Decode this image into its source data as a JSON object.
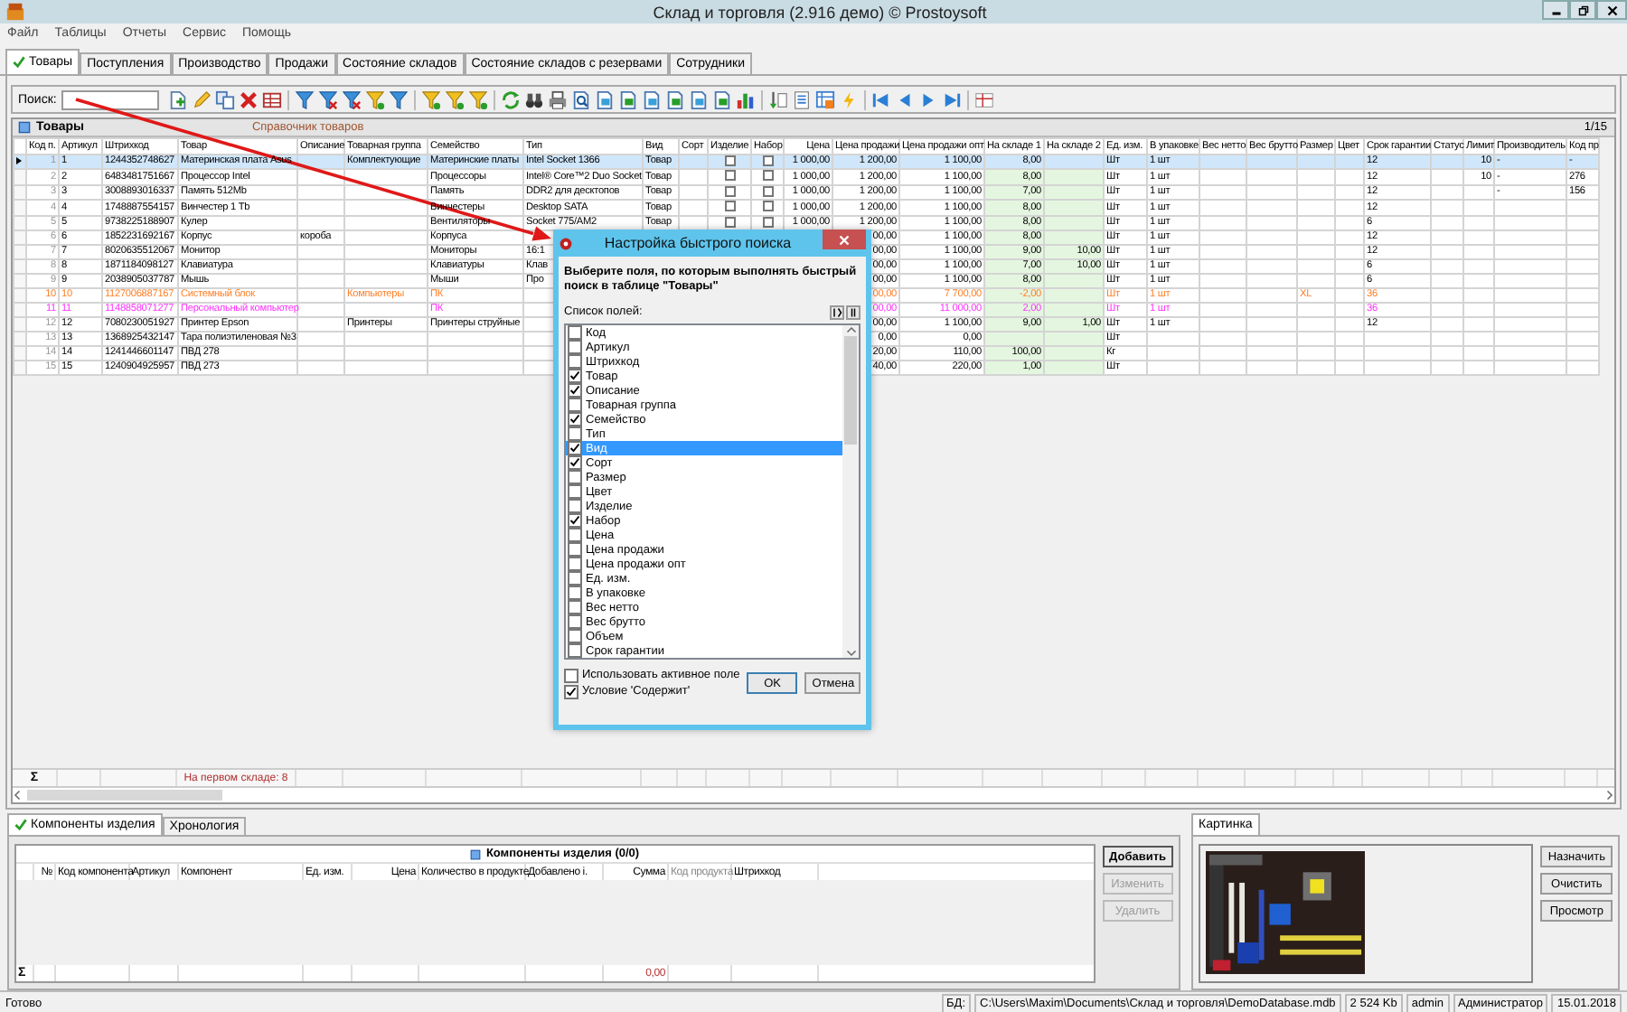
{
  "window": {
    "title": "Склад и торговля (2.916 демо) © Prostoysoft"
  },
  "menu": [
    "Файл",
    "Таблицы",
    "Отчеты",
    "Сервис",
    "Помощь"
  ],
  "tabs": [
    {
      "label": "Товары",
      "selected": true
    },
    {
      "label": "Поступления",
      "selected": false
    },
    {
      "label": "Производство",
      "selected": false
    },
    {
      "label": "Продажи",
      "selected": false
    },
    {
      "label": "Состояние складов",
      "selected": false
    },
    {
      "label": "Состояние складов с резервами",
      "selected": false
    },
    {
      "label": "Сотрудники",
      "selected": false
    }
  ],
  "search": {
    "label": "Поиск:"
  },
  "products": {
    "title": "Товары",
    "subtitle": "Справочник товаров",
    "counter": "1/15",
    "columns": [
      {
        "label": "Код п.",
        "kind": "code"
      },
      {
        "label": "Артикул",
        "kind": "text"
      },
      {
        "label": "Штрихкод",
        "kind": "text"
      },
      {
        "label": "Товар",
        "kind": "text"
      },
      {
        "label": "Описание",
        "kind": "text"
      },
      {
        "label": "Товарная группа",
        "kind": "text"
      },
      {
        "label": "Семейство",
        "kind": "text"
      },
      {
        "label": "Тип",
        "kind": "text"
      },
      {
        "label": "Вид",
        "kind": "text"
      },
      {
        "label": "Сорт",
        "kind": "text"
      },
      {
        "label": "Изделие",
        "kind": "check"
      },
      {
        "label": "Набор",
        "kind": "check"
      },
      {
        "label": "Цена",
        "kind": "number"
      },
      {
        "label": "Цена продажи",
        "kind": "number"
      },
      {
        "label": "Цена продажи опт",
        "kind": "number"
      },
      {
        "label": "На складе 1",
        "kind": "stock"
      },
      {
        "label": "На складе 2",
        "kind": "stock"
      },
      {
        "label": "Ед. изм.",
        "kind": "text"
      },
      {
        "label": "В упаковке",
        "kind": "text"
      },
      {
        "label": "Вес нетто",
        "kind": "text"
      },
      {
        "label": "Вес брутто",
        "kind": "text"
      },
      {
        "label": "Размер",
        "kind": "text"
      },
      {
        "label": "Цвет",
        "kind": "text"
      },
      {
        "label": "Срок гарантии",
        "kind": "text"
      },
      {
        "label": "Статус",
        "kind": "text"
      },
      {
        "label": "Лимит",
        "kind": "number"
      },
      {
        "label": "Производитель",
        "kind": "text"
      },
      {
        "label": "Код пр",
        "kind": "text"
      }
    ],
    "rows": [
      {
        "selected": true,
        "cells": [
          "1",
          "1",
          "1244352748627",
          "Материнская плата Asus",
          null,
          "Комплектующие",
          "Материнские платы",
          "Intel Socket 1366",
          "Товар",
          null,
          false,
          false,
          "1 000,00",
          "1 200,00",
          "1 100,00",
          "8,00",
          null,
          "Шт",
          "1 шт",
          null,
          null,
          null,
          null,
          "12",
          null,
          "10",
          "-",
          "-"
        ]
      },
      {
        "selected": false,
        "cells": [
          "2",
          "2",
          "6483481751667",
          "Процессор Intel",
          null,
          null,
          "Процессоры",
          "Intel® Core™2 Duo Socket",
          "Товар",
          null,
          false,
          false,
          "1 000,00",
          "1 200,00",
          "1 100,00",
          "8,00",
          null,
          "Шт",
          "1 шт",
          null,
          null,
          null,
          null,
          "12",
          null,
          "10",
          "-",
          "276"
        ]
      },
      {
        "selected": false,
        "cells": [
          "3",
          "3",
          "3008893016337",
          "Память 512Mb",
          null,
          null,
          "Память",
          "DDR2 для десктопов",
          "Товар",
          null,
          false,
          false,
          "1 000,00",
          "1 200,00",
          "1 100,00",
          "7,00",
          null,
          "Шт",
          "1 шт",
          null,
          null,
          null,
          null,
          "12",
          null,
          null,
          "-",
          "156"
        ]
      },
      {
        "selected": false,
        "cells": [
          "4",
          "4",
          "1748887554157",
          "Винчестер 1 Tb",
          null,
          null,
          "Винчестеры",
          "Desktop SATA",
          "Товар",
          null,
          false,
          false,
          "1 000,00",
          "1 200,00",
          "1 100,00",
          "8,00",
          null,
          "Шт",
          "1 шт",
          null,
          null,
          null,
          null,
          "12",
          null,
          null,
          null,
          null
        ]
      },
      {
        "selected": false,
        "cells": [
          "5",
          "5",
          "9738225188907",
          "Кулер",
          null,
          null,
          "Вентиляторы",
          "Socket 775/AM2",
          "Товар",
          null,
          false,
          false,
          "1 000,00",
          "1 200,00",
          "1 100,00",
          "8,00",
          null,
          "Шт",
          "1 шт",
          null,
          null,
          null,
          null,
          "6",
          null,
          null,
          null,
          null
        ]
      },
      {
        "selected": false,
        "cells": [
          "6",
          "6",
          "1852231692167",
          "Корпус",
          "короба",
          null,
          "Корпуса",
          null,
          null,
          null,
          null,
          null,
          null,
          "00,00",
          "1 100,00",
          "8,00",
          null,
          "Шт",
          "1 шт",
          null,
          null,
          null,
          null,
          "12",
          null,
          null,
          null,
          null
        ]
      },
      {
        "selected": false,
        "cells": [
          "7",
          "7",
          "8020635512067",
          "Монитор",
          null,
          null,
          "Мониторы",
          "16:1",
          null,
          null,
          null,
          null,
          null,
          "00,00",
          "1 100,00",
          "9,00",
          "10,00",
          "Шт",
          "1 шт",
          null,
          null,
          null,
          null,
          "12",
          null,
          null,
          null,
          null
        ]
      },
      {
        "selected": false,
        "cells": [
          "8",
          "8",
          "1871184098127",
          "Клавиатура",
          null,
          null,
          "Клавиатуры",
          "Клав",
          null,
          null,
          null,
          null,
          null,
          "00,00",
          "1 100,00",
          "7,00",
          "10,00",
          "Шт",
          "1 шт",
          null,
          null,
          null,
          null,
          "6",
          null,
          null,
          null,
          null
        ]
      },
      {
        "selected": false,
        "cells": [
          "9",
          "9",
          "2038905037787",
          "Мышь",
          null,
          null,
          "Мыши",
          "Про",
          null,
          null,
          null,
          null,
          null,
          "00,00",
          "1 100,00",
          "8,00",
          null,
          "Шт",
          "1 шт",
          null,
          null,
          null,
          null,
          "6",
          null,
          null,
          null,
          null
        ]
      },
      {
        "selected": false,
        "color": "#ff7f27",
        "cells": [
          "10",
          "10",
          "1127006887167",
          "Системный блок",
          null,
          "Компьютеры",
          "ПК",
          null,
          null,
          null,
          null,
          null,
          null,
          "00,00",
          "7 700,00",
          "-2,00",
          null,
          "Шт",
          "1 шт",
          null,
          null,
          "XL",
          null,
          "36",
          null,
          null,
          null,
          null
        ]
      },
      {
        "selected": false,
        "color": "#ff33ff",
        "cells": [
          "11",
          "11",
          "1148858071277",
          "Персональный компьютер",
          null,
          null,
          "ПК",
          null,
          null,
          null,
          null,
          null,
          null,
          "00,00",
          "11 000,00",
          "2,00",
          null,
          "Шт",
          "1 шт",
          null,
          null,
          null,
          null,
          "36",
          null,
          null,
          null,
          null
        ]
      },
      {
        "selected": false,
        "cells": [
          "12",
          "12",
          "7080230051927",
          "Принтер Epson",
          null,
          "Принтеры",
          "Принтеры струйные",
          null,
          null,
          null,
          null,
          null,
          null,
          "00,00",
          "1 100,00",
          "9,00",
          "1,00",
          "Шт",
          "1 шт",
          null,
          null,
          null,
          null,
          "12",
          null,
          null,
          null,
          null
        ]
      },
      {
        "selected": false,
        "cells": [
          "13",
          "13",
          "1368925432147",
          "Тара полиэтиленовая №3",
          null,
          null,
          null,
          null,
          null,
          null,
          null,
          null,
          null,
          "0,00",
          "0,00",
          null,
          null,
          "Шт",
          null,
          null,
          null,
          null,
          null,
          null,
          null,
          null,
          null,
          null
        ]
      },
      {
        "selected": false,
        "cells": [
          "14",
          "14",
          "1241446601147",
          "ПВД 278",
          null,
          null,
          null,
          null,
          null,
          null,
          null,
          null,
          null,
          "20,00",
          "110,00",
          "100,00",
          null,
          "Кг",
          null,
          null,
          null,
          null,
          null,
          null,
          null,
          null,
          null,
          null
        ]
      },
      {
        "selected": false,
        "cells": [
          "15",
          "15",
          "1240904925957",
          "ПВД 273",
          null,
          null,
          null,
          null,
          null,
          null,
          null,
          null,
          null,
          "40,00",
          "220,00",
          "1,00",
          null,
          "Шт",
          null,
          null,
          null,
          null,
          null,
          null,
          null,
          null,
          null,
          null
        ]
      }
    ],
    "sum_sign": "Σ",
    "summary": "На первом складе: 8"
  },
  "quick_search_dialog": {
    "title": "Настройка быстрого поиска",
    "prompt": "Выберите поля, по которым выполнять быстрый поиск в таблице \"Товары\"",
    "list_label": "Список полей:",
    "fields": [
      {
        "label": "Код",
        "checked": false,
        "selected": false
      },
      {
        "label": "Артикул",
        "checked": false,
        "selected": false
      },
      {
        "label": "Штрихкод",
        "checked": false,
        "selected": false
      },
      {
        "label": "Товар",
        "checked": true,
        "selected": false
      },
      {
        "label": "Описание",
        "checked": true,
        "selected": false
      },
      {
        "label": "Товарная группа",
        "checked": false,
        "selected": false
      },
      {
        "label": "Семейство",
        "checked": true,
        "selected": false
      },
      {
        "label": "Тип",
        "checked": false,
        "selected": false
      },
      {
        "label": "Вид",
        "checked": true,
        "selected": true
      },
      {
        "label": "Сорт",
        "checked": true,
        "selected": false
      },
      {
        "label": "Размер",
        "checked": false,
        "selected": false
      },
      {
        "label": "Цвет",
        "checked": false,
        "selected": false
      },
      {
        "label": "Изделие",
        "checked": false,
        "selected": false
      },
      {
        "label": "Набор",
        "checked": true,
        "selected": false
      },
      {
        "label": "Цена",
        "checked": false,
        "selected": false
      },
      {
        "label": "Цена продажи",
        "checked": false,
        "selected": false
      },
      {
        "label": "Цена продажи опт",
        "checked": false,
        "selected": false
      },
      {
        "label": "Ед. изм.",
        "checked": false,
        "selected": false
      },
      {
        "label": "В упаковке",
        "checked": false,
        "selected": false
      },
      {
        "label": "Вес нетто",
        "checked": false,
        "selected": false
      },
      {
        "label": "Вес брутто",
        "checked": false,
        "selected": false
      },
      {
        "label": "Объем",
        "checked": false,
        "selected": false
      },
      {
        "label": "Срок гарантии",
        "checked": false,
        "selected": false
      }
    ],
    "options": [
      {
        "label": "Использовать активное поле",
        "checked": false
      },
      {
        "label": "Условие 'Содержит'",
        "checked": true
      }
    ],
    "buttons": [
      "OK",
      "Отмена"
    ]
  },
  "bottom_tabs": [
    {
      "label": "Компоненты изделия",
      "selected": true
    },
    {
      "label": "Хронология",
      "selected": false
    }
  ],
  "components": {
    "title": "Компоненты изделия (0/0)",
    "columns": [
      {
        "label": "№",
        "kind": "number"
      },
      {
        "label": "Код компонента",
        "kind": "text"
      },
      {
        "label": "Артикул",
        "kind": "text"
      },
      {
        "label": "Компонент",
        "kind": "text"
      },
      {
        "label": "Ед. изм.",
        "kind": "text"
      },
      {
        "label": "Цена",
        "kind": "number"
      },
      {
        "label": "Количество в продукте",
        "kind": "text"
      },
      {
        "label": "Добавлено i.",
        "kind": "text"
      },
      {
        "label": "Сумма",
        "kind": "number"
      },
      {
        "label": "Код продукта",
        "kind": "muted"
      },
      {
        "label": "Штрихкод",
        "kind": "text"
      }
    ],
    "sum_sign": "Σ",
    "total": "0,00",
    "buttons": [
      {
        "label": "Добавить",
        "default": true,
        "disabled": false
      },
      {
        "label": "Изменить",
        "default": false,
        "disabled": true
      },
      {
        "label": "Удалить",
        "default": false,
        "disabled": true
      }
    ]
  },
  "image_panel": {
    "tab": "Картинка",
    "buttons": [
      "Назначить",
      "Очистить",
      "Просмотр"
    ]
  },
  "status_bar": {
    "message": "Готово",
    "fields": [
      "БД:",
      "C:\\Users\\Maxim\\Documents\\Склад и торговля\\DemoDatabase.mdb",
      "2 524 Kb",
      "admin",
      "Администратор",
      "15.01.2018"
    ]
  }
}
